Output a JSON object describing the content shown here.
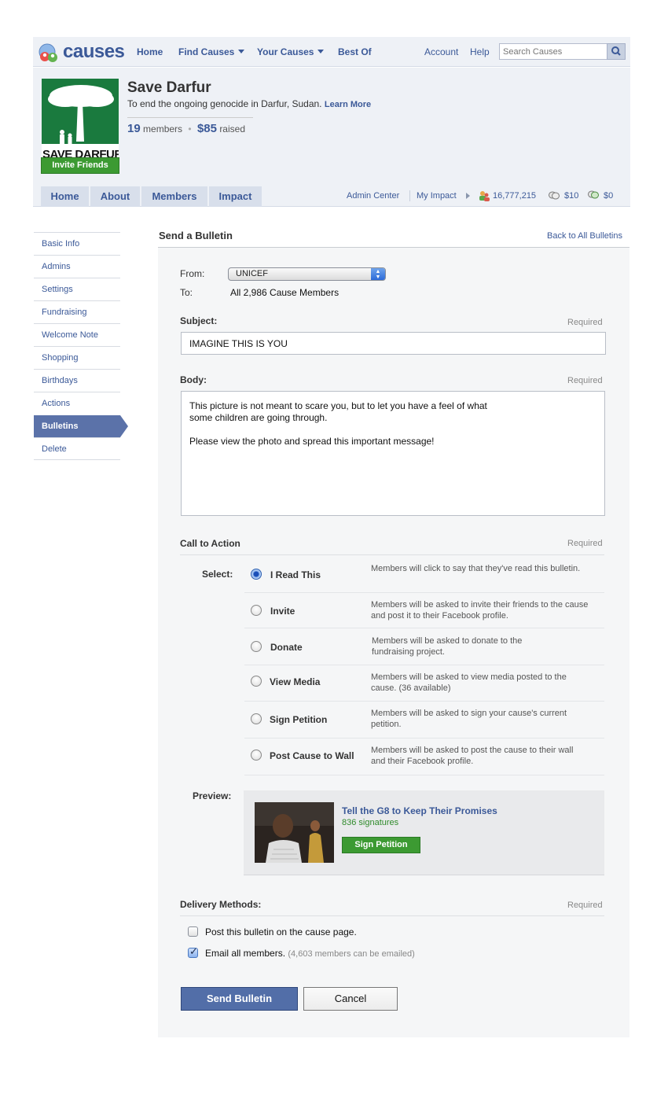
{
  "topnav": {
    "logo_text": "causes",
    "links": [
      "Home",
      "Find Causes",
      "Your Causes",
      "Best Of"
    ],
    "right_links": [
      "Account",
      "Help"
    ],
    "search_placeholder": "Search Causes"
  },
  "cause": {
    "title": "Save Darfur",
    "description": "To end the ongoing genocide in Darfur, Sudan.",
    "learn_more": "Learn More",
    "members_count": "19",
    "members_label": "members",
    "raised_amount": "$85",
    "raised_label": "raised",
    "logo_text": "SAVE DARFUR",
    "invite_button": "Invite Friends",
    "tabs": [
      "Home",
      "About",
      "Members",
      "Impact"
    ],
    "admin_center": "Admin Center",
    "my_impact": "My Impact",
    "impact_people": "16,777,215",
    "impact_money_1": "$10",
    "impact_money_2": "$0"
  },
  "sidebar": {
    "items": [
      "Basic Info",
      "Admins",
      "Settings",
      "Fundraising",
      "Welcome Note",
      "Shopping",
      "Birthdays",
      "Actions",
      "Bulletins",
      "Delete"
    ],
    "active": "Bulletins"
  },
  "bulletin": {
    "title": "Send a Bulletin",
    "back_link": "Back to All Bulletins",
    "from_label": "From:",
    "from_value": "UNICEF",
    "to_label": "To:",
    "to_value": "All 2,986 Cause Members",
    "subject_label": "Subject:",
    "subject_value": "IMAGINE THIS IS YOU",
    "required": "Required",
    "body_label": "Body:",
    "body_value": "This picture is not meant to scare you, but to let you have a feel of what\nsome children are going through.\n\nPlease view the photo and spread this important message!",
    "cta_label": "Call to Action",
    "select_label": "Select:",
    "options": [
      {
        "label": "I Read This",
        "desc": "Members will click to say that they've read this bulletin.",
        "selected": true
      },
      {
        "label": "Invite",
        "desc": "Members will be asked to invite their friends to the cause and post it to their Facebook profile.",
        "selected": false
      },
      {
        "label": "Donate",
        "desc": "Members will be asked to donate to the fundraising project.",
        "selected": false
      },
      {
        "label": "View Media",
        "desc": "Members will be asked to view media posted to the cause. (36 available)",
        "selected": false
      },
      {
        "label": "Sign Petition",
        "desc": "Members will be asked to sign your cause's current petition.",
        "selected": false
      },
      {
        "label": "Post Cause to Wall",
        "desc": "Members will be asked to post the cause to their wall and their Facebook profile.",
        "selected": false
      }
    ],
    "preview_label": "Preview:",
    "preview": {
      "title": "Tell the G8 to Keep Their Promises",
      "signatures": "836 signatures",
      "button": "Sign Petition"
    },
    "delivery_label": "Delivery Methods:",
    "delivery": [
      {
        "label": "Post this bulletin on the cause page.",
        "note": "",
        "checked": false
      },
      {
        "label": "Email all members.",
        "note": "(4,603 members can be emailed)",
        "checked": true
      }
    ],
    "send_button": "Send Bulletin",
    "cancel_button": "Cancel"
  },
  "colors": {
    "brand_blue": "#3b5998",
    "action_green": "#3c9a32",
    "active_sidebar": "#5b72a9",
    "send_button": "#526ea8"
  }
}
